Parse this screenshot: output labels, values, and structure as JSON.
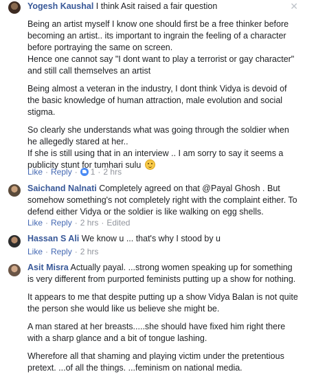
{
  "comments": [
    {
      "author": "Yogesh Kaushal",
      "intro": " I think Asit raised a fair question",
      "paragraphs": [
        "Being an artist myself I know one should first be a free thinker before becoming an artist.. its important to ingrain the feeling of a character before portraying the same on screen.",
        "Hence one cannot say \"I dont want to play a terrorist or gay character\" and still call themselves an artist",
        "Being almost a veteran in the industry, I dont think Vidya is devoid of the basic knowledge of human attraction, male evolution and social stigma.",
        "So clearly she understands what was going through the soldier when he allegedly stared at her..",
        "If she is still using that in an interview .. I am sorry to say it seems a publicity stunt for tumhari sulu"
      ],
      "like_label": "Like",
      "reply_label": "Reply",
      "reaction_count": "1",
      "time": "2 hrs"
    },
    {
      "author": "Saichand Nalnati",
      "intro": " Completely agreed on that @Payal Ghosh . But somehow something's not completely right with the complaint either. To defend either Vidya or the soldier is like walking on egg shells.",
      "like_label": "Like",
      "reply_label": "Reply",
      "time": "2 hrs",
      "edited": "Edited"
    },
    {
      "author": "Hassan S Ali",
      "intro": " We know u ... that's why I stood by u",
      "like_label": "Like",
      "reply_label": "Reply",
      "time": "2 hrs"
    },
    {
      "author": "Asit Misra",
      "intro": " Actually payal. ...strong women speaking up for something is very different from purported feminists putting up a show for nothing.",
      "paragraphs": [
        "It appears to me that despite putting up a show Vidya Balan is not quite the person she would like us believe she might be.",
        "A man stared at her breasts.....she should have fixed him right there with a sharp glance and a bit of tongue lashing.",
        "Wherefore all that shaming and playing victim under the pretentious pretext. ...of all the things. ...feminism on national media."
      ]
    }
  ],
  "icons": {
    "close": "close-icon",
    "like_reaction": "like-reaction-icon",
    "emoji": "slightly-smiling-emoji"
  },
  "colors": {
    "name": "#385898",
    "action": "#4267b2",
    "meta": "#90949c"
  }
}
